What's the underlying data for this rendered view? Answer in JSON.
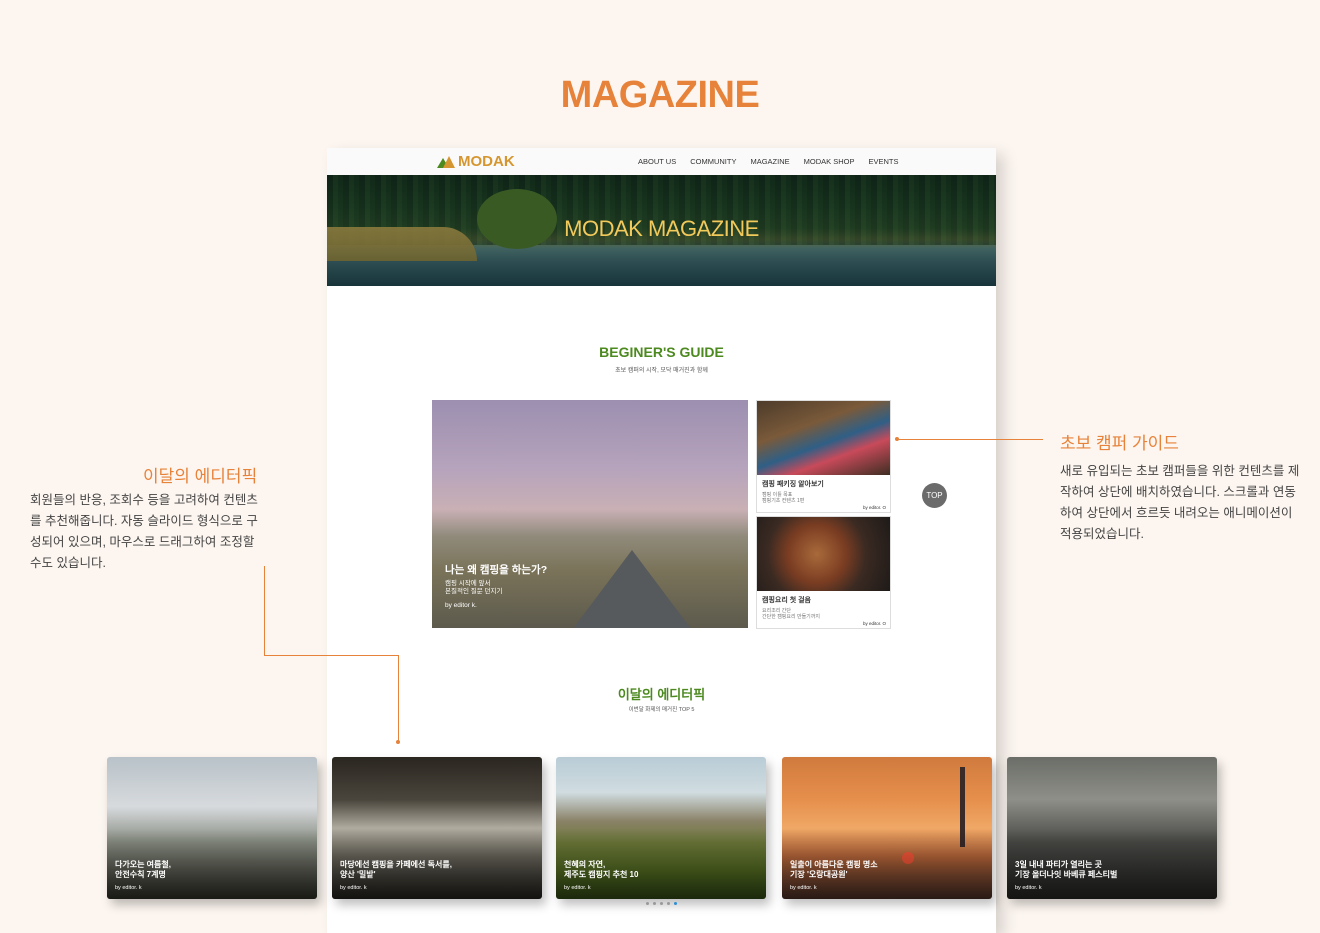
{
  "page": {
    "title": "MAGAZINE"
  },
  "site": {
    "logo": "MODAK",
    "nav": [
      "ABOUT US",
      "COMMUNITY",
      "MAGAZINE",
      "MODAK SHOP",
      "EVENTS"
    ],
    "hero_title": "MODAK MAGAZINE",
    "guide": {
      "title": "BEGINER'S GUIDE",
      "subtitle": "초보 캠퍼의 시작, 모닥 매거진과 함께",
      "feature": {
        "title": "나는 왜 캠핑을 하는가?",
        "desc_1": "캠핑 시작에 앞서",
        "desc_2": "본질적인 질문 던지기",
        "by": "by editor k."
      },
      "cards": [
        {
          "title": "캠핑 패키징 알아보기",
          "desc_1": "캠핑 이틀 목표",
          "desc_2": "캠핑기초 컨텐츠 1편",
          "by": "by editor. O"
        },
        {
          "title": "캠핑요리 첫 걸음",
          "desc_1": "요리조리 간단",
          "desc_2": "간단한 캠핑요리 만들기까지",
          "by": "by editor. O"
        }
      ]
    },
    "top_button": "TOP",
    "picks": {
      "title": "이달의 에디터픽",
      "subtitle": "이번달 화제의 매거진 TOP 5"
    }
  },
  "annotations": {
    "left": {
      "title": "이달의 에디터픽",
      "body": "회원들의 반응, 조회수 등을 고려하여 컨텐츠를 추천해줍니다. 자동 슬라이드 형식으로 구성되어 있으며, 마우스로 드래그하여 조정할 수도 있습니다."
    },
    "right": {
      "title": "초보 캠퍼 가이드",
      "body": "새로 유입되는 초보 캠퍼들을 위한 컨텐츠를 제작하여 상단에 배치하였습니다. 스크롤과 연동하여 상단에서 흐르듯 내려오는 애니메이션이 적용되었습니다."
    }
  },
  "slides": [
    {
      "title": "다가오는 여름철,\n안전수칙 7계명",
      "by": "by editor. k"
    },
    {
      "title": "마당에선 캠핑을 카페에선 독서를,\n양산 '밀밭'",
      "by": "by editor. k"
    },
    {
      "title": "천혜의 자연,\n제주도 캠핑지 추천 10",
      "by": "by editor. k"
    },
    {
      "title": "일출이 아름다운 캠핑 명소\n기장 '오랑대공원'",
      "by": "by editor. k"
    },
    {
      "title": "3일 내내 파티가 열리는 곳\n기장 올더나잇 바베큐 페스티벌",
      "by": "by editor. k"
    }
  ],
  "pager": {
    "count": 5,
    "active": 4
  },
  "colors": {
    "accent": "#e7823a",
    "green": "#4c8a1f",
    "logo": "#d6962f"
  }
}
